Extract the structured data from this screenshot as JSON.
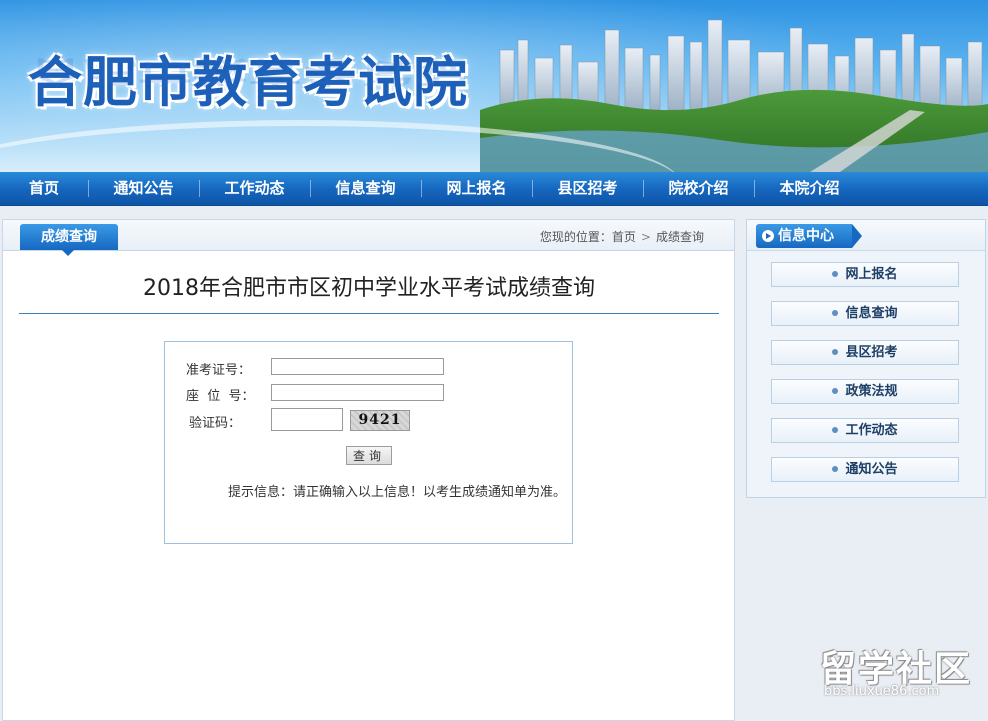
{
  "header": {
    "title": "合肥市教育考试院"
  },
  "nav": {
    "items": [
      {
        "label": "首页"
      },
      {
        "label": "通知公告"
      },
      {
        "label": "工作动态"
      },
      {
        "label": "信息查询"
      },
      {
        "label": "网上报名"
      },
      {
        "label": "县区招考"
      },
      {
        "label": "院校介绍"
      },
      {
        "label": "本院介绍"
      }
    ]
  },
  "main": {
    "tab_label": "成绩查询",
    "breadcrumb": {
      "prefix": "您现的位置：",
      "home": "首页",
      "separator": ">",
      "current": "成绩查询"
    },
    "page_title": "2018年合肥市市区初中学业水平考试成绩查询",
    "form": {
      "exam_id_label": "准考证号：",
      "exam_id_value": "",
      "seat_label": "座  位  号：",
      "seat_value": "",
      "captcha_label": "验证码：",
      "captcha_value": "",
      "captcha_text": "9421",
      "submit_label": "查询",
      "hint": "提示信息：请正确输入以上信息！以考生成绩通知单为准。"
    }
  },
  "sidebar": {
    "title": "信息中心",
    "items": [
      {
        "label": "网上报名"
      },
      {
        "label": "信息查询"
      },
      {
        "label": "县区招考"
      },
      {
        "label": "政策法规"
      },
      {
        "label": "工作动态"
      },
      {
        "label": "通知公告"
      }
    ]
  },
  "watermark": {
    "text": "留学社区",
    "url": "bbs.liuxue86.com"
  },
  "colors": {
    "nav_blue": "#1565bd",
    "accent_blue": "#1668c1",
    "title_blue": "#1c5fb8"
  }
}
